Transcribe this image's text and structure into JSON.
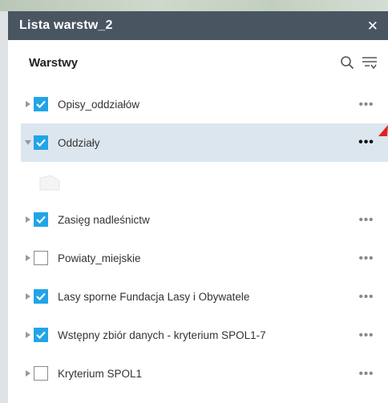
{
  "panel": {
    "title": "Lista warstw_2",
    "close_icon": "close-icon",
    "heading": "Warstwy"
  },
  "tools": {
    "search_icon": "search-icon",
    "filter_icon": "filter-icon"
  },
  "layers": [
    {
      "label": "Opisy_oddziałów",
      "checked": true,
      "expanded": false
    },
    {
      "label": "Oddziały",
      "checked": true,
      "expanded": true,
      "selected": true
    },
    {
      "label": "Zasięg nadleśnictw",
      "checked": true,
      "expanded": false
    },
    {
      "label": "Powiaty_miejskie",
      "checked": false,
      "expanded": false
    },
    {
      "label": "Lasy sporne Fundacja Lasy i Obywatele",
      "checked": true,
      "expanded": false
    },
    {
      "label": "Wstępny zbiór danych - kryterium SPOL1-7",
      "checked": true,
      "expanded": false
    },
    {
      "label": "Kryterium SPOL1",
      "checked": false,
      "expanded": false
    }
  ],
  "more_label": "•••",
  "colors": {
    "titlebar": "#4a5562",
    "checkbox_checked": "#21a5e7",
    "selected_row": "#dce6ef",
    "marker": "#e02020"
  }
}
